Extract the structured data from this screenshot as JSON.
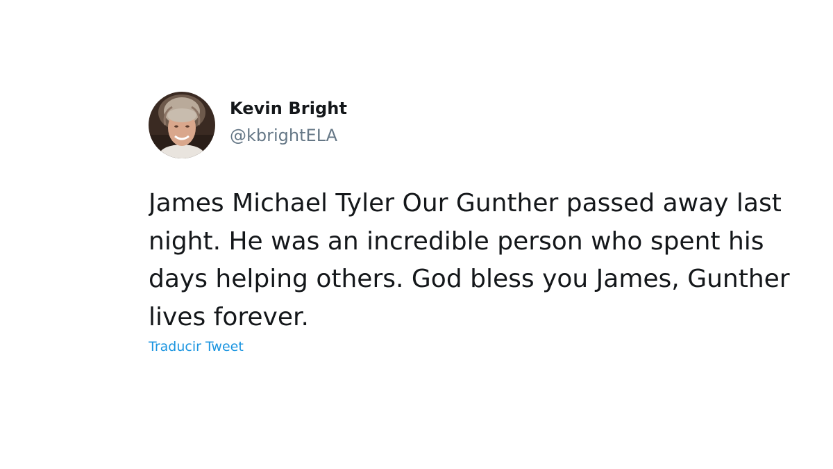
{
  "tweet": {
    "author": {
      "display_name": "Kevin Bright",
      "handle": "@kbrightELA"
    },
    "text_lines": [
      "James Michael Tyler Our Gunther passed away last",
      "night. He was an incredible person who spent his",
      "days helping others. God bless you James, Gunther",
      "lives forever."
    ],
    "translate_label": "Traducir Tweet"
  },
  "colors": {
    "background": "#ffffff",
    "text_primary": "#14171a",
    "text_secondary": "#657786",
    "link": "#1b95e0"
  }
}
